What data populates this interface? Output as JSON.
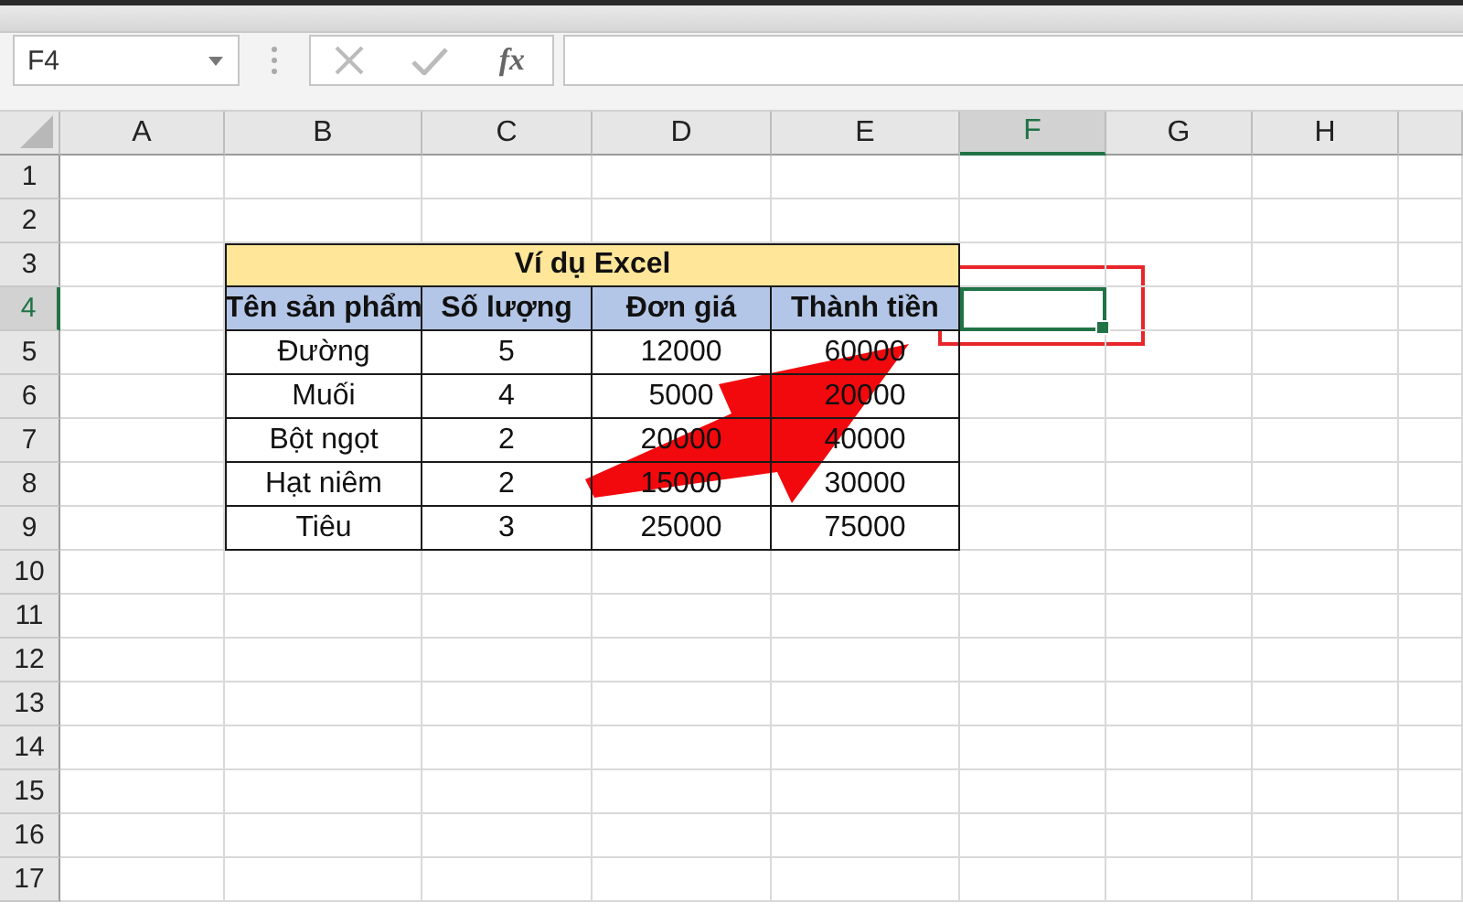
{
  "name_box": {
    "value": "F4"
  },
  "formula_bar": {
    "function_button": "fx"
  },
  "columns": [
    {
      "label": "A",
      "selected": false
    },
    {
      "label": "B",
      "selected": false
    },
    {
      "label": "C",
      "selected": false
    },
    {
      "label": "D",
      "selected": false
    },
    {
      "label": "E",
      "selected": false
    },
    {
      "label": "F",
      "selected": true
    },
    {
      "label": "G",
      "selected": false
    },
    {
      "label": "H",
      "selected": false
    }
  ],
  "rows": [
    {
      "label": "1",
      "selected": false
    },
    {
      "label": "2",
      "selected": false
    },
    {
      "label": "3",
      "selected": false
    },
    {
      "label": "4",
      "selected": true
    },
    {
      "label": "5",
      "selected": false
    },
    {
      "label": "6",
      "selected": false
    },
    {
      "label": "7",
      "selected": false
    },
    {
      "label": "8",
      "selected": false
    },
    {
      "label": "9",
      "selected": false
    },
    {
      "label": "10",
      "selected": false
    },
    {
      "label": "11",
      "selected": false
    },
    {
      "label": "12",
      "selected": false
    },
    {
      "label": "13",
      "selected": false
    },
    {
      "label": "14",
      "selected": false
    },
    {
      "label": "15",
      "selected": false
    },
    {
      "label": "16",
      "selected": false
    },
    {
      "label": "17",
      "selected": false
    }
  ],
  "table": {
    "title": "Ví dụ Excel",
    "columns": [
      "Tên sản phẩm",
      "Số lượng",
      "Đơn giá",
      "Thành tiền"
    ],
    "rows": [
      [
        "Đường",
        "5",
        "12000",
        "60000"
      ],
      [
        "Muối",
        "4",
        "5000",
        "20000"
      ],
      [
        "Bột ngọt",
        "2",
        "20000",
        "40000"
      ],
      [
        "Hạt niêm",
        "2",
        "15000",
        "30000"
      ],
      [
        "Tiêu",
        "3",
        "25000",
        "75000"
      ]
    ]
  },
  "annotations": [
    {
      "kind": "rectangle",
      "color": "#e8262a"
    },
    {
      "kind": "arrow",
      "color": "#f2090d"
    }
  ]
}
